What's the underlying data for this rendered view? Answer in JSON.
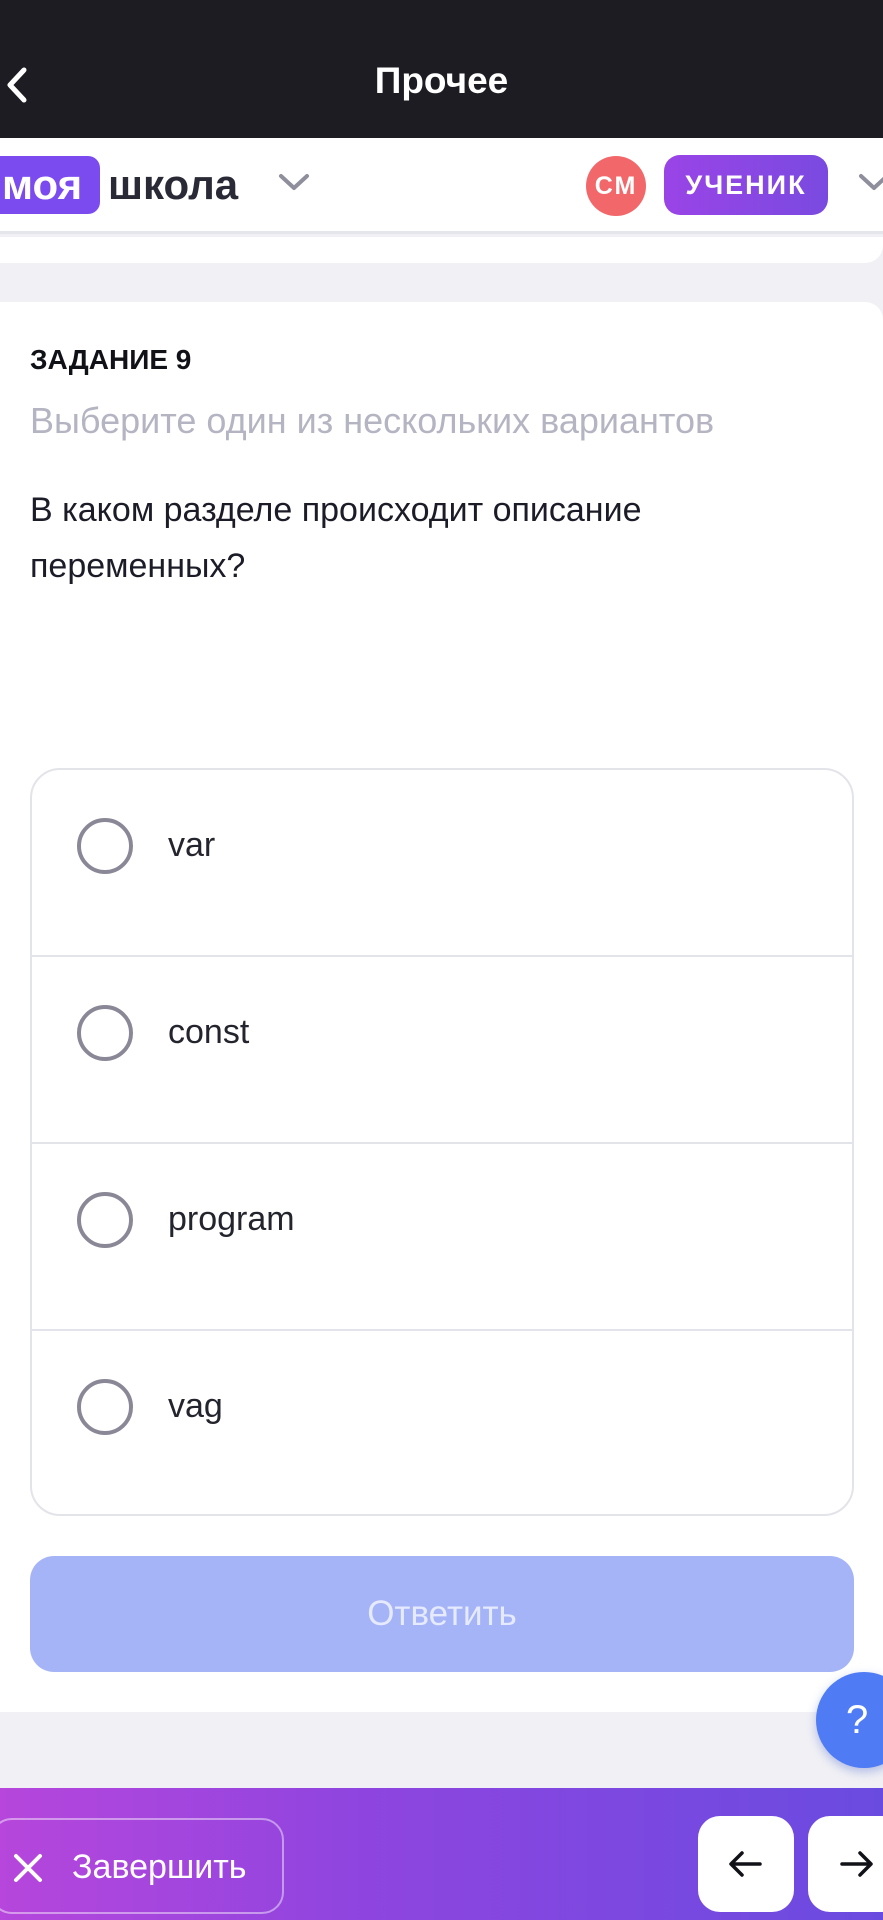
{
  "header": {
    "title": "Прочее"
  },
  "brand": {
    "logo_part1": "моя",
    "logo_part2": "школа",
    "avatar_initials": "СМ",
    "role": "УЧЕНИК"
  },
  "task": {
    "label": "ЗАДАНИЕ 9",
    "hint": "Выберите один из нескольких вариантов",
    "question": "В каком разделе происходит описание переменных?",
    "options": [
      {
        "label": "var",
        "selected": false
      },
      {
        "label": "const",
        "selected": false
      },
      {
        "label": "program",
        "selected": false
      },
      {
        "label": "vag",
        "selected": false
      }
    ],
    "answer_label": "Ответить"
  },
  "help": {
    "label": "?"
  },
  "footer": {
    "finish_label": "Завершить"
  },
  "colors": {
    "topbar": "#1c1c22",
    "logo_bg": "#7b4bf0",
    "avatar_bg": "#f2686a",
    "answer_disabled": "#a5b4f7",
    "help_bg": "#4f7cf4"
  }
}
